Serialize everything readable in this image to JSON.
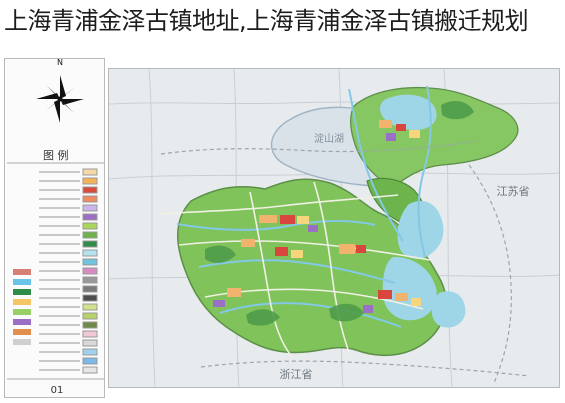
{
  "title": "上海青浦金泽古镇地址,上海青浦金泽古镇搬迁规划",
  "legend": {
    "heading": "图 例",
    "north_label": "N",
    "page_number": "01"
  },
  "map": {
    "labels": [
      {
        "text": "淀山湖",
        "name": "dianshan-lake-label"
      },
      {
        "text": "江苏省",
        "name": "jiangsu-province-label"
      },
      {
        "text": "浙江省",
        "name": "zhejiang-province-label"
      }
    ]
  },
  "colors": {
    "urban_green": "#7fbf4f",
    "dark_green": "#4f9c4a",
    "water_blue": "#9ed5e7",
    "residential": "#f1b36e",
    "commercial": "#d9463e",
    "industrial": "#9a6fc5"
  }
}
